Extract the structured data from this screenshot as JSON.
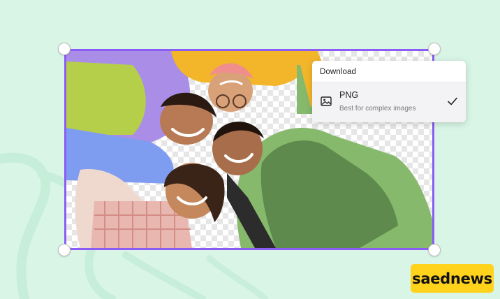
{
  "download_menu": {
    "title": "Download",
    "option": {
      "label": "PNG",
      "description": "Best for complex images",
      "icon": "image-icon",
      "selected": true
    }
  },
  "watermark": {
    "text": "saednews"
  },
  "colors": {
    "background": "#d9f5e6",
    "selection_border": "#8b5cf6",
    "badge": "#ffd21c"
  }
}
